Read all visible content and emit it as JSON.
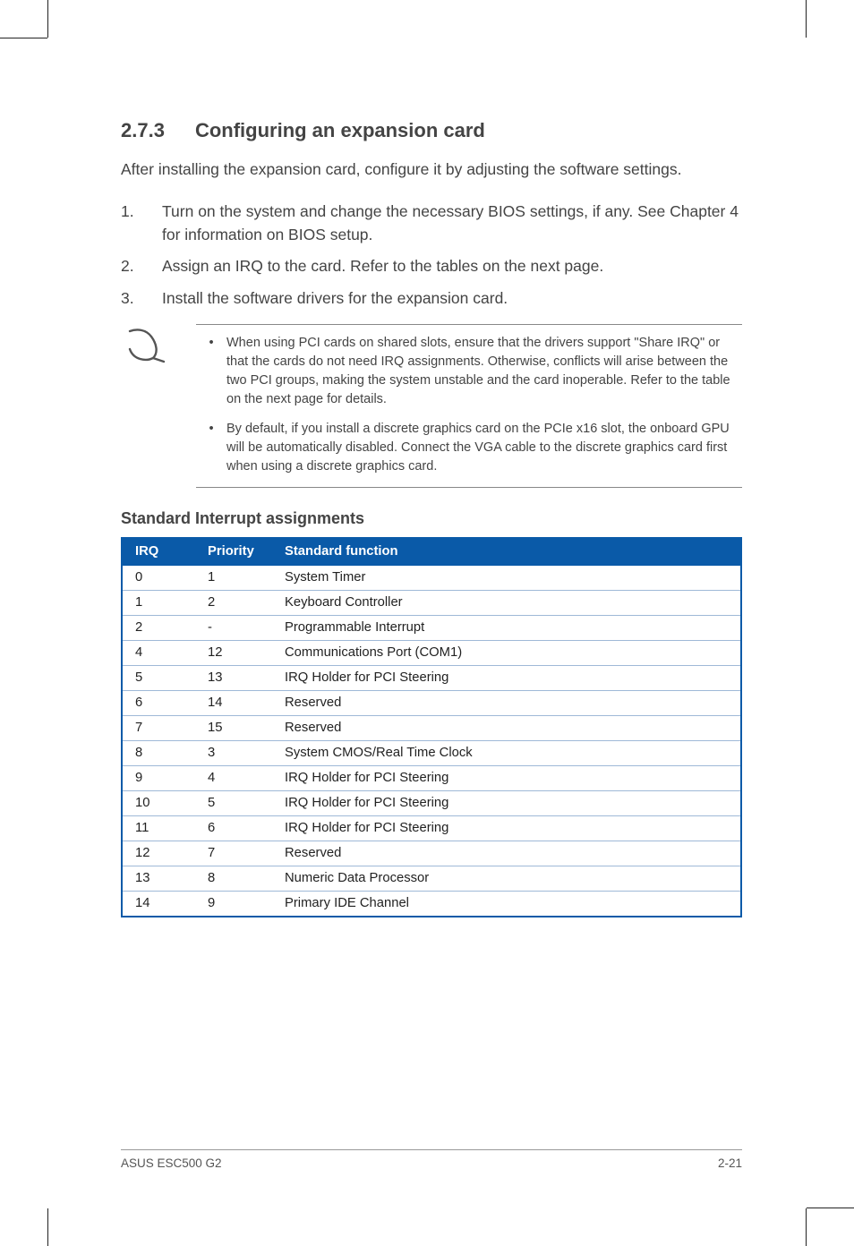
{
  "heading": {
    "number": "2.7.3",
    "title": "Configuring an expansion card"
  },
  "intro": "After installing the expansion card, configure it by adjusting the software settings.",
  "steps": [
    {
      "n": "1.",
      "t": "Turn on the system and change the necessary BIOS settings, if any. See Chapter 4 for information on BIOS setup."
    },
    {
      "n": "2.",
      "t": "Assign an IRQ to the card. Refer to the tables on the next page."
    },
    {
      "n": "3.",
      "t": "Install the software drivers for the expansion card."
    }
  ],
  "notes": [
    "When using PCI cards on shared slots, ensure that the drivers support \"Share IRQ\" or that the cards do not need IRQ assignments. Otherwise, conflicts will arise between the two PCI groups, making the system unstable and the card inoperable. Refer to the table on the next page for details.",
    "By default, if you install a discrete graphics card on the PCIe x16 slot, the onboard GPU will be automatically disabled. Connect the VGA cable to the discrete graphics card first when using a discrete graphics card."
  ],
  "table_title": "Standard Interrupt assignments",
  "table_headers": {
    "c1": "IRQ",
    "c2": "Priority",
    "c3": "Standard function"
  },
  "rows": [
    {
      "irq": "0",
      "pr": "1",
      "fn": "System Timer"
    },
    {
      "irq": "1",
      "pr": "2",
      "fn": "Keyboard Controller"
    },
    {
      "irq": "2",
      "pr": "-",
      "fn": "Programmable Interrupt"
    },
    {
      "irq": "4",
      "pr": "12",
      "fn": "Communications Port (COM1)"
    },
    {
      "irq": "5",
      "pr": "13",
      "fn": "IRQ Holder for PCI Steering"
    },
    {
      "irq": "6",
      "pr": "14",
      "fn": "Reserved"
    },
    {
      "irq": "7",
      "pr": "15",
      "fn": "Reserved"
    },
    {
      "irq": "8",
      "pr": "3",
      "fn": "System CMOS/Real Time Clock"
    },
    {
      "irq": "9",
      "pr": "4",
      "fn": "IRQ Holder for PCI Steering"
    },
    {
      "irq": "10",
      "pr": "5",
      "fn": "IRQ Holder for PCI Steering"
    },
    {
      "irq": "11",
      "pr": "6",
      "fn": "IRQ Holder for PCI Steering"
    },
    {
      "irq": "12",
      "pr": "7",
      "fn": "Reserved"
    },
    {
      "irq": "13",
      "pr": "8",
      "fn": "Numeric Data Processor"
    },
    {
      "irq": "14",
      "pr": "9",
      "fn": "Primary IDE Channel"
    }
  ],
  "footer": {
    "left": "ASUS ESC500 G2",
    "right": "2-21"
  }
}
